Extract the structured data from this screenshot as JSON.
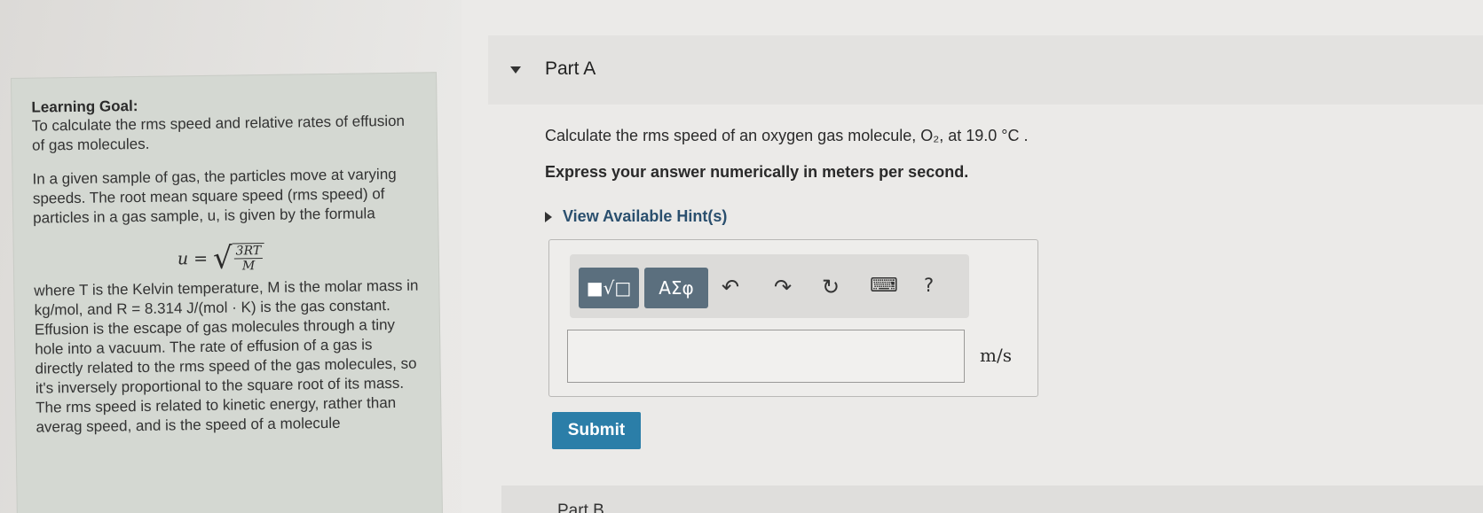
{
  "learning_goal": {
    "title": "Learning Goal:",
    "summary": "To calculate the rms speed and relative rates of effusion of gas molecules.",
    "intro": "In a given sample of gas, the particles move at varying speeds. The root mean square speed (rms speed) of particles in a gas sample, u, is given by the formula",
    "formula_lhs": "u =",
    "formula_num": "3RT",
    "formula_den": "M",
    "explanation": "where T is the Kelvin temperature, M is the molar mass in kg/mol, and R = 8.314 J/(mol · K) is the gas constant. Effusion is the escape of gas molecules through a tiny hole into a vacuum. The rate of effusion of a gas is directly related to the rms speed of the gas molecules, so it's inversely proportional to the square root of its mass. The rms speed is related to kinetic energy, rather than averag speed, and is the speed of a molecule"
  },
  "part_a": {
    "title": "Part A",
    "question": "Calculate the rms speed of an oxygen gas molecule, O₂, at 19.0 °C .",
    "instruction": "Express your answer numerically in meters per second.",
    "hint_label": "View Available Hint(s)",
    "toolbar": {
      "template_btn": "■√□",
      "symbols_btn": "ΑΣφ",
      "undo": "↶",
      "redo": "↷",
      "reset": "↻",
      "keyboard": "⌨",
      "help": "?"
    },
    "answer_value": "",
    "unit": "m/s",
    "submit_label": "Submit"
  },
  "part_b": {
    "title": "Part B"
  }
}
